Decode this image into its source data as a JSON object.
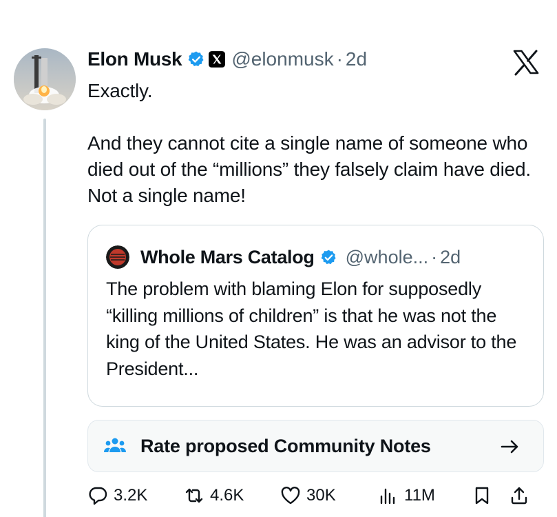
{
  "tweet": {
    "author_name": "Elon Musk",
    "handle": "@elonmusk",
    "separator": "·",
    "time": "2d",
    "avatar_icon": "starship-launch-avatar",
    "paragraphs": [
      "Exactly.",
      "And they cannot cite a single name of someone who died out of the “millions” they falsely claim have died. Not a single name!"
    ]
  },
  "quote": {
    "author_name": "Whole Mars Catalog",
    "handle": "@whole...",
    "separator": "·",
    "time": "2d",
    "text": "The problem with blaming Elon for supposedly “killing millions of children” is that he was not the king of the United States. He was an advisor to the President..."
  },
  "community_notes": {
    "label": "Rate proposed Community Notes",
    "icon": "people-icon",
    "arrow_icon": "arrow-right-icon"
  },
  "actions": {
    "replies": "3.2K",
    "reposts": "4.6K",
    "likes": "30K",
    "views": "11M"
  },
  "colors": {
    "text": "#0f1419",
    "secondary": "#536471",
    "verified": "#1d9bf0",
    "border": "#cfd9de"
  }
}
